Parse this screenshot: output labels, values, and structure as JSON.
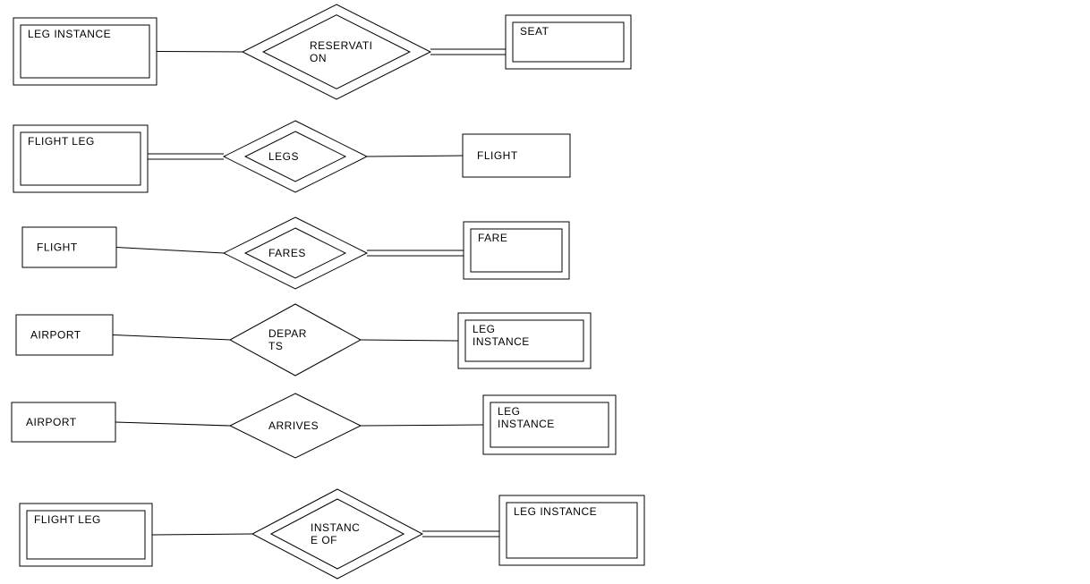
{
  "diagram": {
    "type": "er-diagram-fragments",
    "rows": [
      {
        "left": {
          "label": "LEG INSTANCE",
          "weak": true
        },
        "rel": {
          "label": "RESERVATION",
          "identifying": true,
          "wrap": [
            "RESERVATI",
            "ON"
          ]
        },
        "right": {
          "label": "SEAT",
          "weak": true
        },
        "leftDouble": false,
        "rightDouble": true
      },
      {
        "left": {
          "label": "FLIGHT LEG",
          "weak": true
        },
        "rel": {
          "label": "LEGS",
          "identifying": true,
          "wrap": [
            "LEGS"
          ]
        },
        "right": {
          "label": "FLIGHT",
          "weak": false
        },
        "leftDouble": true,
        "rightDouble": false
      },
      {
        "left": {
          "label": "FLIGHT",
          "weak": false
        },
        "rel": {
          "label": "FARES",
          "identifying": true,
          "wrap": [
            "FARES"
          ]
        },
        "right": {
          "label": "FARE",
          "weak": true
        },
        "leftDouble": false,
        "rightDouble": true
      },
      {
        "left": {
          "label": "AIRPORT",
          "weak": false
        },
        "rel": {
          "label": "DEPARTS",
          "identifying": false,
          "wrap": [
            "DEPAR",
            "TS"
          ]
        },
        "right": {
          "label": "LEG INSTANCE",
          "weak": true,
          "wrap": [
            "LEG",
            "INSTANCE"
          ]
        },
        "leftDouble": false,
        "rightDouble": false
      },
      {
        "left": {
          "label": "AIRPORT",
          "weak": false
        },
        "rel": {
          "label": "ARRIVES",
          "identifying": false,
          "wrap": [
            "ARRIVES"
          ]
        },
        "right": {
          "label": "LEG INSTANCE",
          "weak": true,
          "wrap": [
            "LEG",
            "INSTANCE"
          ]
        },
        "leftDouble": false,
        "rightDouble": false
      },
      {
        "left": {
          "label": "FLIGHT LEG",
          "weak": true
        },
        "rel": {
          "label": "INSTANCE OF",
          "identifying": true,
          "wrap": [
            "INSTANC",
            "E OF"
          ]
        },
        "right": {
          "label": "LEG INSTANCE",
          "weak": true
        },
        "leftDouble": false,
        "rightDouble": true
      }
    ]
  }
}
